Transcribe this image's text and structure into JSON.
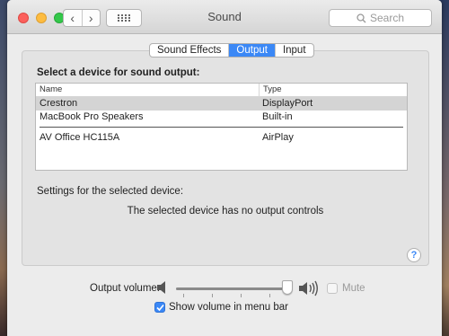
{
  "window": {
    "title": "Sound",
    "search_placeholder": "Search",
    "nav_back": "‹",
    "nav_forward": "›"
  },
  "tabs": [
    {
      "label": "Sound Effects",
      "active": false
    },
    {
      "label": "Output",
      "active": true
    },
    {
      "label": "Input",
      "active": false
    }
  ],
  "output": {
    "section_title": "Select a device for sound output:",
    "columns": [
      "Name",
      "Type"
    ],
    "devices": [
      {
        "name": "Crestron",
        "type": "DisplayPort",
        "selected": true
      },
      {
        "name": "MacBook Pro Speakers",
        "type": "Built-in",
        "selected": false
      },
      {
        "name": "AV Office HC115A",
        "type": "AirPlay",
        "selected": false
      }
    ],
    "settings_label": "Settings for the selected device:",
    "no_controls_message": "The selected device has no output controls",
    "help_label": "?"
  },
  "volume": {
    "label": "Output volume:",
    "level": 0.95,
    "mute_label": "Mute",
    "muted": false,
    "show_in_menu_bar_label": "Show volume in menu bar",
    "show_in_menu_bar": true
  },
  "colors": {
    "accent": "#3b88f6",
    "selected_row": "#d4d4d4",
    "window_bg": "#ececec"
  }
}
